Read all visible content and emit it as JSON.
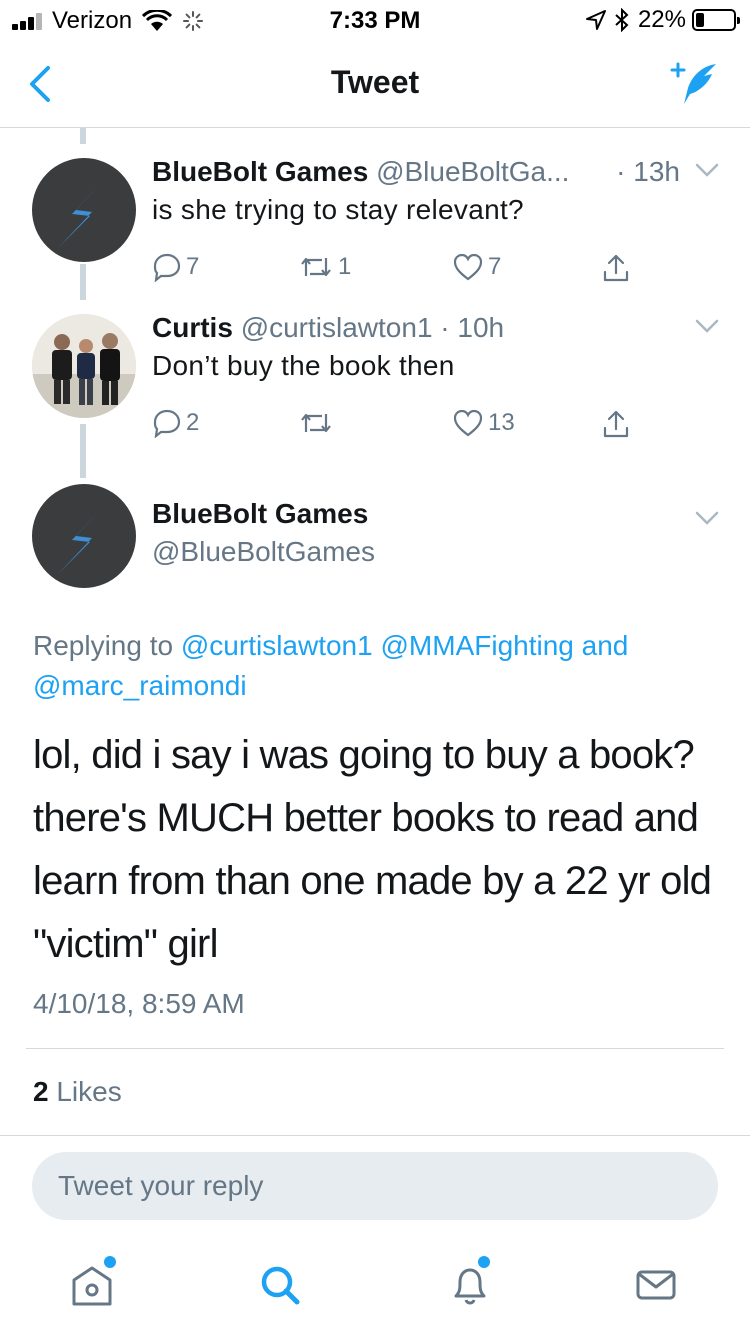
{
  "status_bar": {
    "carrier": "Verizon",
    "time": "7:33 PM",
    "battery_percent": "22%",
    "battery_level": 0.22
  },
  "nav": {
    "title": "Tweet",
    "back_icon": "chevron-left-icon",
    "compose_icon": "compose-tweet-icon"
  },
  "thread": [
    {
      "name": "BlueBolt Games",
      "handle": "@BlueBoltGa...",
      "time": "· 13h",
      "text": "is she trying to stay relevant?",
      "replies": "7",
      "retweets": "1",
      "likes": "7"
    },
    {
      "name": "Curtis",
      "handle": "@curtislawton1 · 10h",
      "time": "",
      "text": "Don’t buy the book then",
      "replies": "2",
      "retweets": "",
      "likes": "13"
    }
  ],
  "main_tweet": {
    "name": "BlueBolt Games",
    "handle": "@BlueBoltGames",
    "replying_prefix": "Replying to",
    "replying_mentions": [
      "@curtislawton1",
      "@MMAFighting",
      "@marc_raimondi"
    ],
    "replying_and": "and",
    "text": "lol, did i say i was going to buy a book? there's MUCH better books to read and learn from than one made by a 22 yr old \"victim\" girl",
    "timestamp": "4/10/18, 8:59 AM",
    "likes_count": "2",
    "likes_label": "Likes"
  },
  "reply_box": {
    "placeholder": "Tweet your reply"
  },
  "tabbar": {
    "tabs": [
      "home-icon",
      "search-icon",
      "notifications-icon",
      "messages-icon"
    ]
  },
  "colors": {
    "accent": "#1da1f2",
    "secondary_text": "#657786",
    "primary_text": "#14171a",
    "thread_line": "#ccd6dd",
    "input_bg": "#e6ecf0"
  }
}
